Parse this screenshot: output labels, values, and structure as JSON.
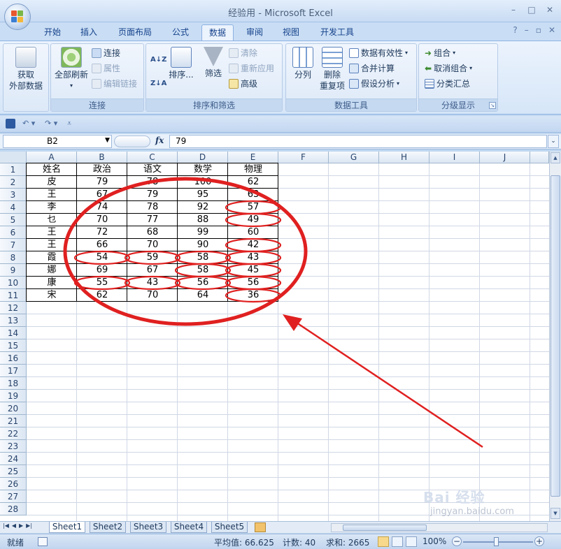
{
  "window": {
    "title": "经验用 - Microsoft Excel",
    "controls": [
      "–",
      "□",
      "✕"
    ]
  },
  "ribbon_tabs": [
    "开始",
    "插入",
    "页面布局",
    "公式",
    "数据",
    "审阅",
    "视图",
    "开发工具"
  ],
  "active_tab": "数据",
  "ribbon": {
    "get_external_data": {
      "label_1": "获取",
      "label_2": "外部数据"
    },
    "connections": {
      "group_label": "连接",
      "refresh_all": "全部刷新",
      "connect": "连接",
      "properties": "属性",
      "edit_links": "编辑链接"
    },
    "sort_filter": {
      "group_label": "排序和筛选",
      "sort": "排序...",
      "filter": "筛选",
      "clear": "清除",
      "reapply": "重新应用",
      "advanced": "高级"
    },
    "data_tools": {
      "group_label": "数据工具",
      "text_to_columns": "分列",
      "remove_dup_1": "删除",
      "remove_dup_2": "重复项",
      "validation": "数据有效性",
      "consolidate": "合并计算",
      "what_if": "假设分析"
    },
    "outline": {
      "group_label": "分级显示",
      "group": "组合",
      "ungroup": "取消组合",
      "subtotal": "分类汇总"
    }
  },
  "formula_bar": {
    "name_box": "B2",
    "fx": "fx",
    "value": "79"
  },
  "columns": [
    "A",
    "B",
    "C",
    "D",
    "E",
    "F",
    "G",
    "H",
    "I",
    "J"
  ],
  "row_numbers": [
    "1",
    "2",
    "3",
    "4",
    "5",
    "6",
    "7",
    "8",
    "9",
    "10",
    "11",
    "12",
    "13",
    "14",
    "15",
    "16",
    "17",
    "18",
    "19",
    "20",
    "21",
    "22",
    "23",
    "24",
    "25",
    "26",
    "27",
    "28"
  ],
  "table": {
    "header": [
      "姓名",
      "政治",
      "语文",
      "数学",
      "物理"
    ],
    "rows": [
      [
        "皮",
        "79",
        "78",
        "100",
        "62"
      ],
      [
        "王",
        "67",
        "79",
        "95",
        "63"
      ],
      [
        "李",
        "74",
        "78",
        "92",
        "57"
      ],
      [
        "乜",
        "70",
        "77",
        "88",
        "49"
      ],
      [
        "王",
        "72",
        "68",
        "99",
        "60"
      ],
      [
        "王",
        "66",
        "70",
        "90",
        "42"
      ],
      [
        "霞",
        "54",
        "59",
        "58",
        "43"
      ],
      [
        "娜",
        "69",
        "67",
        "58",
        "45"
      ],
      [
        "康",
        "55",
        "43",
        "56",
        "56"
      ],
      [
        "宋",
        "62",
        "70",
        "64",
        "36"
      ]
    ]
  },
  "sheets": [
    "Sheet1",
    "Sheet2",
    "Sheet3",
    "Sheet4",
    "Sheet5"
  ],
  "active_sheet": "Sheet1",
  "status": {
    "ready": "就绪",
    "average": "平均值: 66.625",
    "count": "计数: 40",
    "sum": "求和: 2665",
    "zoom": "100%"
  },
  "watermark": {
    "brand": "Bai 经验",
    "url": "jingyan.baidu.com"
  },
  "colors": {
    "annotation": "#e02020",
    "ribbon": "#dbe8f8",
    "active_tab": "#ebf3fd"
  }
}
